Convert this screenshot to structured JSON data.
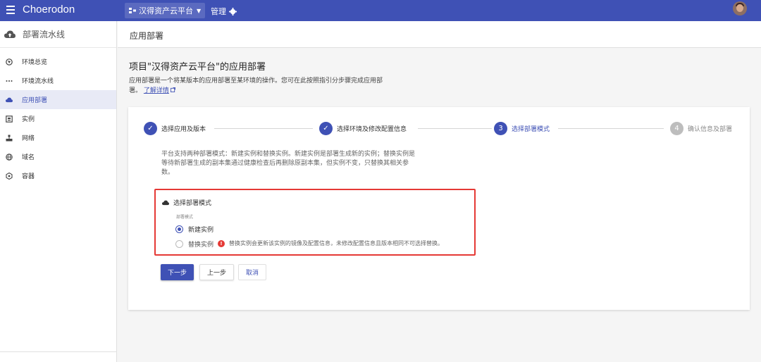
{
  "topbar": {
    "brand": "Choerodon",
    "project": "汉得资产云平台",
    "manage": "管理"
  },
  "sidebar": {
    "header": "部署流水线",
    "items": [
      {
        "label": "环境总览",
        "icon": "environment-icon"
      },
      {
        "label": "环境流水线",
        "icon": "more-dots-icon"
      },
      {
        "label": "应用部署",
        "icon": "cloud-icon",
        "active": true
      },
      {
        "label": "实例",
        "icon": "instance-icon"
      },
      {
        "label": "网络",
        "icon": "network-icon"
      },
      {
        "label": "域名",
        "icon": "globe-icon"
      },
      {
        "label": "容器",
        "icon": "container-icon"
      }
    ]
  },
  "page": {
    "header": "应用部署",
    "title": "项目\"汉得资产云平台\"的应用部署",
    "desc": "应用部署是一个将某版本的应用部署至某环境的操作。您可在此按照指引分步骤完成应用部署。",
    "learn_more": "了解详情"
  },
  "steps": [
    {
      "label": "选择应用及版本",
      "status": "done"
    },
    {
      "label": "选择环境及修改配置信息",
      "status": "done"
    },
    {
      "number": "3",
      "label": "选择部署模式",
      "status": "current"
    },
    {
      "number": "4",
      "label": "确认信息及部署",
      "status": "todo"
    }
  ],
  "platform_desc": "平台支持两种部署模式：新建实例和替换实例。新建实例是部署生成新的实例；替换实例是等待新部署生成的副本集通过健康检查后再删除原副本集，但实例不变，只替换其相关参数。",
  "mode": {
    "title": "选择部署模式",
    "field_label": "部署模式",
    "options": [
      {
        "label": "新建实例",
        "checked": true
      },
      {
        "label": "替换实例",
        "checked": false
      }
    ],
    "warning": "替换实例会更新该实例的镜像及配置信息，未修改配置信息且版本相同不可选择替换。"
  },
  "buttons": {
    "next": "下一步",
    "prev": "上一步",
    "cancel": "取消"
  },
  "colors": {
    "primary": "#3f51b5",
    "highlight_border": "#e53935",
    "warning": "#e53935"
  }
}
